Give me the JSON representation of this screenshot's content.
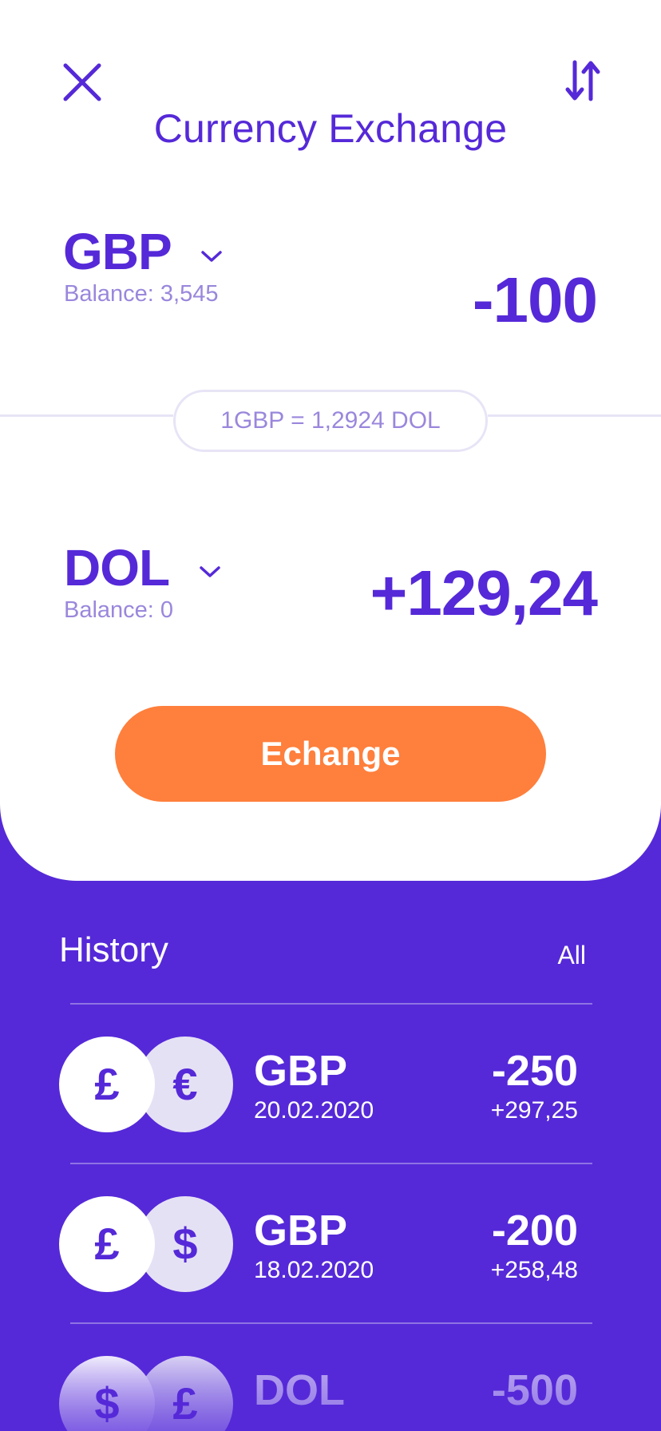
{
  "header": {
    "title": "Currency Exchange",
    "close_icon": "close-icon",
    "swap_icon": "swap-vertical-icon"
  },
  "from": {
    "code": "GBP",
    "balance": "Balance: 3,545",
    "amount": "-100"
  },
  "rate": {
    "text": "1GBP = 1,2924 DOL"
  },
  "to": {
    "code": "DOL",
    "balance": "Balance: 0",
    "amount": "+129,24"
  },
  "exchange_button": {
    "label": "Echange"
  },
  "history": {
    "title": "History",
    "all_label": "All",
    "items": [
      {
        "coin_front": "£",
        "coin_back": "€",
        "code": "GBP",
        "date": "20.02.2020",
        "amount": "-250",
        "converted": "+297,25"
      },
      {
        "coin_front": "£",
        "coin_back": "$",
        "code": "GBP",
        "date": "18.02.2020",
        "amount": "-200",
        "converted": "+258,48"
      },
      {
        "coin_front": "$",
        "coin_back": "£",
        "code": "DOL",
        "date": "",
        "amount": "-500",
        "converted": ""
      }
    ]
  },
  "colors": {
    "primary": "#5529d8",
    "accent": "#ff7f3c",
    "muted": "#9a87dc",
    "background": "#ffffff"
  }
}
